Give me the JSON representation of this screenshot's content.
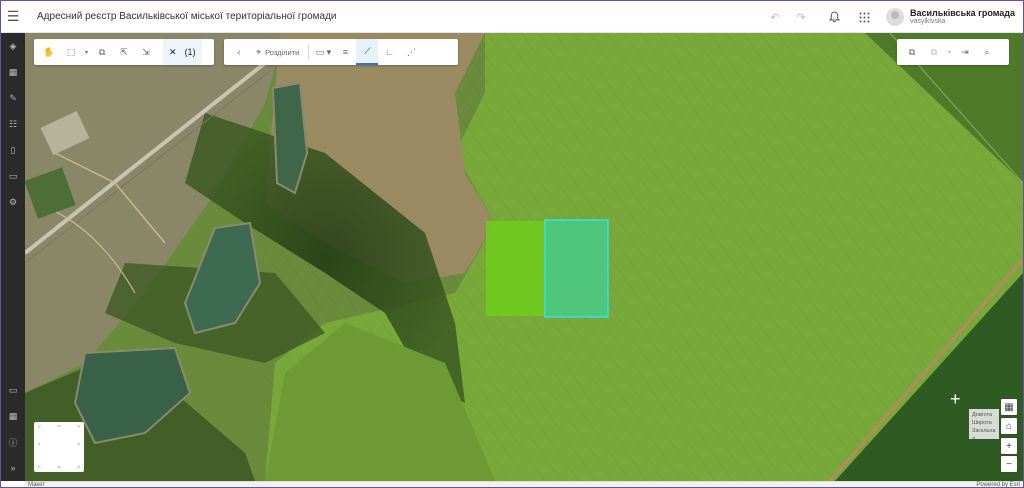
{
  "header": {
    "title": "Адресний реєстр Васильківської міської територіальної громади",
    "user_name": "Васильківська громада",
    "user_login": "vasylkivska"
  },
  "toolbar_select": {
    "selection_count": "(1)"
  },
  "toolbar_edit": {
    "split_label": "Розділити"
  },
  "tooltip": {
    "line1": "Довгота",
    "line2": "Широта",
    "line3": "Загальна д"
  },
  "status": {
    "basemap": "Макет",
    "attribution": "Powered by Esri"
  },
  "icons": {
    "menu": "hamburger-icon",
    "undo": "undo-icon",
    "redo": "redo-icon",
    "notifications": "bell-icon",
    "apps": "app-grid-icon"
  },
  "colors": {
    "selection_green": "#6fcb1f",
    "highlight_teal": "#2ee0c8",
    "accent": "#2a7ab8"
  }
}
